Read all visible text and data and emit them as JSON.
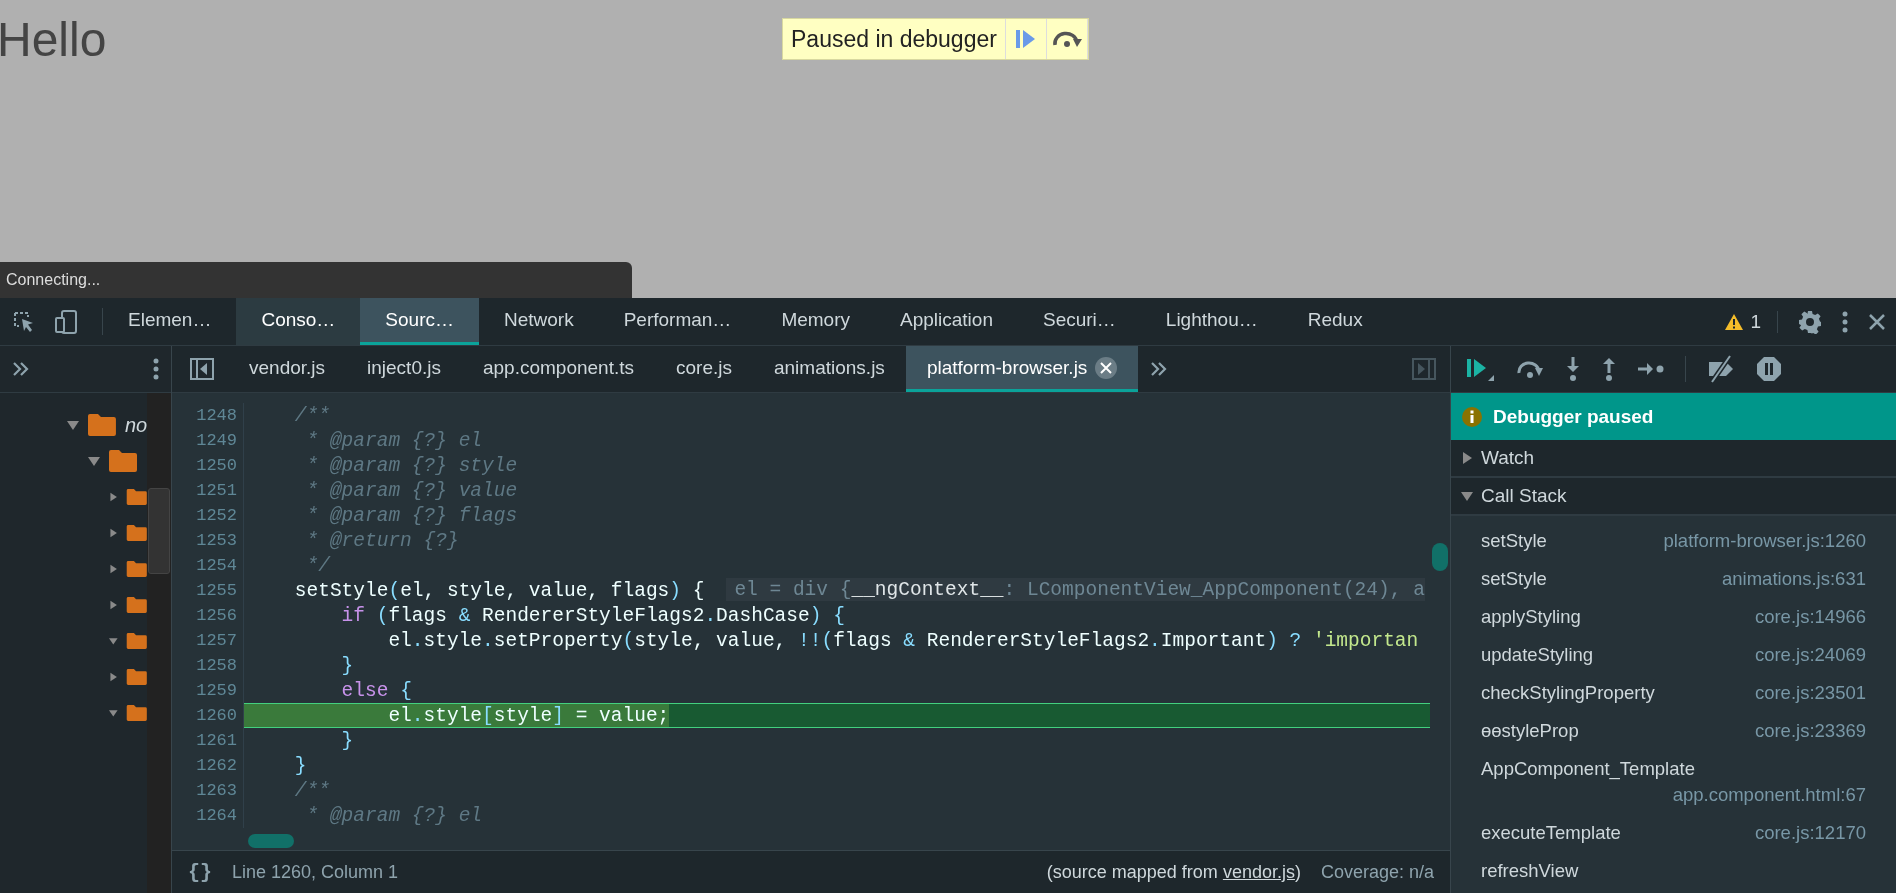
{
  "page": {
    "heading": "Hello",
    "overlay": {
      "message": "Paused in debugger"
    },
    "toast": "Connecting..."
  },
  "devtools": {
    "tabs": [
      {
        "label": "Elemen…",
        "selected": false,
        "hovered": false
      },
      {
        "label": "Conso…",
        "selected": false,
        "hovered": true
      },
      {
        "label": "Sourc…",
        "selected": true,
        "hovered": false
      },
      {
        "label": "Network",
        "selected": false,
        "hovered": false
      },
      {
        "label": "Performan…",
        "selected": false,
        "hovered": false
      },
      {
        "label": "Memory",
        "selected": false,
        "hovered": false
      },
      {
        "label": "Application",
        "selected": false,
        "hovered": false
      },
      {
        "label": "Securi…",
        "selected": false,
        "hovered": false
      },
      {
        "label": "Lighthou…",
        "selected": false,
        "hovered": false
      },
      {
        "label": "Redux",
        "selected": false,
        "hovered": false
      }
    ],
    "warnings": {
      "count": "1"
    },
    "navigator": {
      "tree": [
        {
          "label": "no",
          "expanded": true,
          "children": [
            {
              "expanded": true,
              "children": [
                {
                  "expanded": false
                },
                {
                  "expanded": false
                },
                {
                  "expanded": false
                },
                {
                  "expanded": false
                },
                {
                  "expanded": true
                },
                {
                  "expanded": false
                },
                {
                  "expanded": true
                }
              ]
            }
          ]
        }
      ]
    },
    "file_tabs": [
      {
        "label": "vendor.js",
        "selected": false
      },
      {
        "label": "inject0.js",
        "selected": false
      },
      {
        "label": "app.component.ts",
        "selected": false
      },
      {
        "label": "core.js",
        "selected": false
      },
      {
        "label": "animations.js",
        "selected": false
      },
      {
        "label": "platform-browser.js",
        "selected": true
      }
    ],
    "editor": {
      "lines": [
        {
          "number": "1248",
          "current": false,
          "tokens": [
            {
              "kind": "comment",
              "text": "    /**"
            }
          ]
        },
        {
          "number": "1249",
          "current": false,
          "tokens": [
            {
              "kind": "comment",
              "text": "     * @param {?} el"
            }
          ]
        },
        {
          "number": "1250",
          "current": false,
          "tokens": [
            {
              "kind": "comment",
              "text": "     * @param {?} style"
            }
          ]
        },
        {
          "number": "1251",
          "current": false,
          "tokens": [
            {
              "kind": "comment",
              "text": "     * @param {?} value"
            }
          ]
        },
        {
          "number": "1252",
          "current": false,
          "tokens": [
            {
              "kind": "comment",
              "text": "     * @param {?} flags"
            }
          ]
        },
        {
          "number": "1253",
          "current": false,
          "tokens": [
            {
              "kind": "comment",
              "text": "     * @return {?}"
            }
          ]
        },
        {
          "number": "1254",
          "current": false,
          "tokens": [
            {
              "kind": "comment",
              "text": "     */"
            }
          ]
        },
        {
          "number": "1255",
          "current": false,
          "tokens": [
            {
              "kind": "text",
              "text": "    setStyle"
            },
            {
              "kind": "punct",
              "text": "("
            },
            {
              "kind": "text",
              "text": "el, style, value, flags"
            },
            {
              "kind": "punct",
              "text": ")"
            },
            {
              "kind": "text",
              "text": " {"
            }
          ],
          "hint": "el = div {**__ngContext__**: LComponentView_AppComponent(24), a"
        },
        {
          "number": "1256",
          "current": false,
          "tokens": [
            {
              "kind": "keyword",
              "text": "        if"
            },
            {
              "kind": "punct",
              "text": " ("
            },
            {
              "kind": "text",
              "text": "flags "
            },
            {
              "kind": "punct",
              "text": "&"
            },
            {
              "kind": "text",
              "text": " RendererStyleFlags2"
            },
            {
              "kind": "punct",
              "text": "."
            },
            {
              "kind": "text",
              "text": "DashCase"
            },
            {
              "kind": "punct",
              "text": ") {"
            }
          ]
        },
        {
          "number": "1257",
          "current": false,
          "tokens": [
            {
              "kind": "text",
              "text": "            el"
            },
            {
              "kind": "punct",
              "text": "."
            },
            {
              "kind": "text",
              "text": "style"
            },
            {
              "kind": "punct",
              "text": "."
            },
            {
              "kind": "text",
              "text": "setProperty"
            },
            {
              "kind": "punct",
              "text": "("
            },
            {
              "kind": "text",
              "text": "style, value, "
            },
            {
              "kind": "punct",
              "text": "!!("
            },
            {
              "kind": "text",
              "text": "flags "
            },
            {
              "kind": "punct",
              "text": "&"
            },
            {
              "kind": "text",
              "text": " RendererStyleFlags2"
            },
            {
              "kind": "punct",
              "text": "."
            },
            {
              "kind": "text",
              "text": "Important"
            },
            {
              "kind": "punct",
              "text": ") ?"
            },
            {
              "kind": "string",
              "text": " 'importan"
            }
          ]
        },
        {
          "number": "1258",
          "current": false,
          "tokens": [
            {
              "kind": "punct",
              "text": "        }"
            }
          ]
        },
        {
          "number": "1259",
          "current": false,
          "tokens": [
            {
              "kind": "keyword",
              "text": "        else"
            },
            {
              "kind": "punct",
              "text": " {"
            }
          ]
        },
        {
          "number": "1260",
          "current": true,
          "tokens": [
            {
              "kind": "text",
              "text": "            el"
            },
            {
              "kind": "punct",
              "text": "."
            },
            {
              "kind": "text",
              "text": "style"
            },
            {
              "kind": "punct",
              "text": "["
            },
            {
              "kind": "text",
              "text": "style"
            },
            {
              "kind": "punct",
              "text": "]"
            },
            {
              "kind": "text",
              "text": " = value;"
            }
          ]
        },
        {
          "number": "1261",
          "current": false,
          "tokens": [
            {
              "kind": "punct",
              "text": "        }"
            }
          ]
        },
        {
          "number": "1262",
          "current": false,
          "tokens": [
            {
              "kind": "punct",
              "text": "    }"
            }
          ]
        },
        {
          "number": "1263",
          "current": false,
          "tokens": [
            {
              "kind": "comment",
              "text": "    /**"
            }
          ]
        },
        {
          "number": "1264",
          "current": false,
          "tokens": [
            {
              "kind": "comment",
              "text": "     * @param {?} el"
            }
          ]
        }
      ]
    },
    "status_bar": {
      "pretty_print": "{}",
      "position": "Line 1260, Column 1",
      "source_map": {
        "prefix": "(source mapped from ",
        "link": "vendor.js",
        "suffix": ")"
      },
      "coverage": "Coverage: n/a"
    },
    "debugger": {
      "banner": "Debugger paused",
      "sections": [
        {
          "title": "Watch",
          "expanded": false
        },
        {
          "title": "Call Stack",
          "expanded": true
        }
      ],
      "call_stack": [
        {
          "name": "setStyle",
          "location": "platform-browser.js:1260"
        },
        {
          "name": "setStyle",
          "location": "animations.js:631"
        },
        {
          "name": "applyStyling",
          "location": "core.js:14966"
        },
        {
          "name": "updateStyling",
          "location": "core.js:24069"
        },
        {
          "name": "checkStylingProperty",
          "location": "core.js:23501"
        },
        {
          "name": "ɵɵstyleProp",
          "location": "core.js:23369"
        },
        {
          "name": "AppComponent_Template",
          "location": "app.component.html:67"
        },
        {
          "name": "executeTemplate",
          "location": "core.js:12170"
        },
        {
          "name": "refreshView"
        }
      ]
    }
  }
}
